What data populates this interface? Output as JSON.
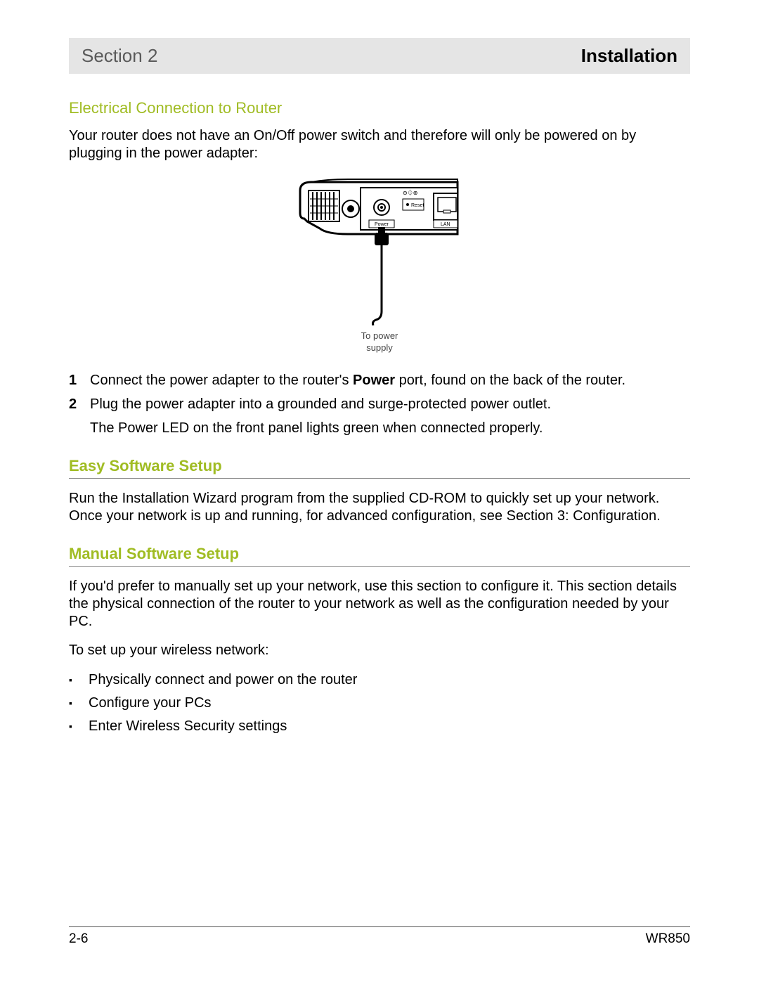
{
  "header": {
    "section_label": "Section 2",
    "title": "Installation"
  },
  "section1": {
    "heading": "Electrical Connection to Router",
    "intro": "Your router does not have an On/Off power switch and therefore will only be powered on by plugging in the power adapter:"
  },
  "illustration": {
    "labels": {
      "reset": "Reset",
      "power": "Power",
      "lan": "LAN"
    },
    "caption_line1": "To power",
    "caption_line2": "supply"
  },
  "steps": [
    {
      "num": "1",
      "prefix": "Connect the power adapter to the router's ",
      "bold": "Power",
      "suffix": " port, found on the back of the router."
    },
    {
      "num": "2",
      "prefix": "Plug the power adapter into a grounded and surge-protected power outlet.",
      "bold": "",
      "suffix": ""
    }
  ],
  "step_extra": "The Power LED on the front panel lights green when connected properly.",
  "section2": {
    "heading": "Easy Software Setup",
    "body": "Run the Installation Wizard program from the supplied CD-ROM to quickly set up your network. Once your network is up and running, for advanced configuration, see Section 3: Configuration."
  },
  "section3": {
    "heading": "Manual Software Setup",
    "body1": "If you'd prefer to manually set up your network, use this section to configure it. This section details the physical connection of the router to your network as well as the configuration needed by your PC.",
    "body2": "To set up your wireless network:",
    "bullets": [
      "Physically connect and power on the router",
      "Configure your PCs",
      "Enter Wireless Security settings"
    ]
  },
  "footer": {
    "page": "2-6",
    "model": "WR850"
  }
}
